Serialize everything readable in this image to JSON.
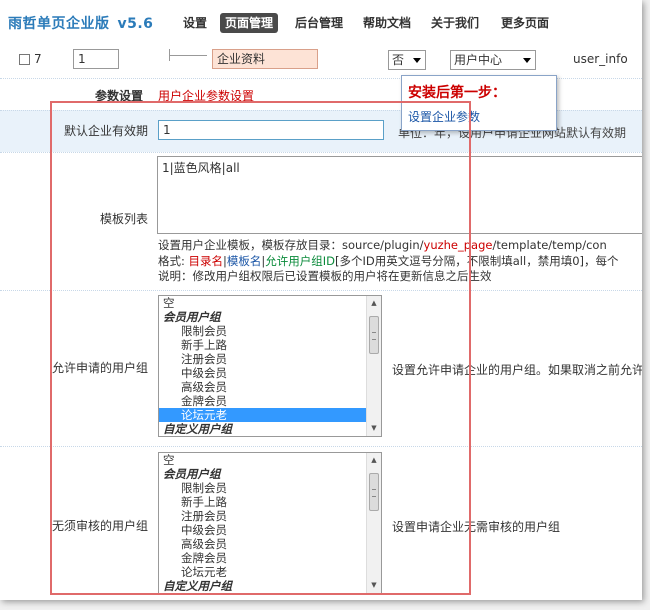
{
  "nav": {
    "title": "雨哲单页企业版",
    "version": "v5.6",
    "items": [
      "设置",
      "页面管理",
      "后台管理",
      "帮助文档",
      "关于我们",
      "更多页面"
    ]
  },
  "page_row": {
    "id": "7",
    "order": "1",
    "name": "企业资料",
    "select_yesno": "否",
    "select_module": "用户中心",
    "identifier": "user_info"
  },
  "tooltip": {
    "title": "安装后第一步：",
    "link": "设置企业参数"
  },
  "params": {
    "label": "参数设置",
    "value": "用户企业参数设置"
  },
  "validity": {
    "label": "默认企业有效期",
    "value": "1",
    "desc": "单位：年，设用户申请企业网站默认有效期"
  },
  "templates": {
    "label": "模板列表",
    "value": "1|蓝色风格|all",
    "desc1_prefix": "设置用户企业模板，模板存放目录：source/plugin/",
    "desc1_highlight": "yuzhe_page",
    "desc1_suffix": "/template/temp/con",
    "desc2_prefix": "格式: ",
    "desc2_dir": "目录名",
    "desc2_sep1": "|",
    "desc2_name": "模板名",
    "desc2_sep2": "|",
    "desc2_group": "允许用户组ID",
    "desc2_rest": "[多个ID用英文逗号分隔，不限制填all，禁用填0]，每个",
    "desc3": "说明：修改用户组权限后已设置模板的用户将在更新信息之后生效"
  },
  "allowed_groups": {
    "label": "允许申请的用户组",
    "desc": "设置允许申请企业的用户组。如果取消之前允许",
    "options": [
      {
        "text": "空",
        "type": "opt"
      },
      {
        "text": "会员用户组",
        "type": "grp"
      },
      {
        "text": "限制会员",
        "type": "child"
      },
      {
        "text": "新手上路",
        "type": "child"
      },
      {
        "text": "注册会员",
        "type": "child"
      },
      {
        "text": "中级会员",
        "type": "child"
      },
      {
        "text": "高级会员",
        "type": "child"
      },
      {
        "text": "金牌会员",
        "type": "child"
      },
      {
        "text": "论坛元老",
        "type": "child",
        "selected": true
      },
      {
        "text": "自定义用户组",
        "type": "grp"
      }
    ]
  },
  "no_review_groups": {
    "label": "无须审核的用户组",
    "desc": "设置申请企业无需审核的用户组",
    "options": [
      {
        "text": "空",
        "type": "opt"
      },
      {
        "text": "会员用户组",
        "type": "grp"
      },
      {
        "text": "限制会员",
        "type": "child"
      },
      {
        "text": "新手上路",
        "type": "child"
      },
      {
        "text": "注册会员",
        "type": "child"
      },
      {
        "text": "中级会员",
        "type": "child"
      },
      {
        "text": "高级会员",
        "type": "child"
      },
      {
        "text": "金牌会员",
        "type": "child"
      },
      {
        "text": "论坛元老",
        "type": "child"
      },
      {
        "text": "自定义用户组",
        "type": "grp"
      }
    ]
  },
  "colors": {
    "accent": "#2b7bb9",
    "highlight_red": "#cc0000",
    "row_blue": "#e9f2fa",
    "select_blue": "#3399ff",
    "annotation_box": "#e06a6a"
  }
}
